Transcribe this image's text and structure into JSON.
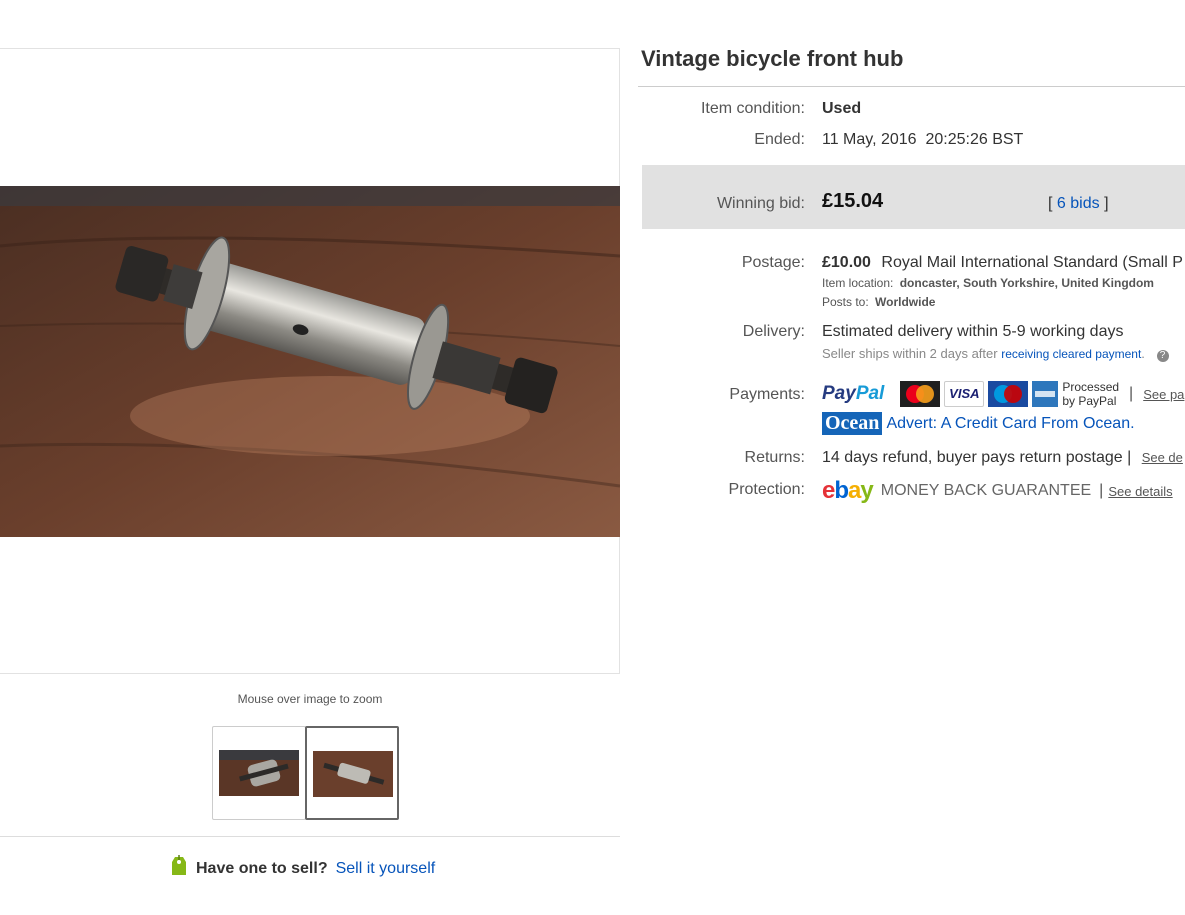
{
  "gallery": {
    "zoom_hint": "Mouse over image to zoom"
  },
  "sell": {
    "question": "Have one to sell?",
    "link": "Sell it yourself"
  },
  "item": {
    "title": "Vintage bicycle front hub",
    "condition_label": "Item condition:",
    "condition_value": "Used",
    "ended_label": "Ended:",
    "ended_value": "11 May, 2016  20:25:26 BST",
    "winning_bid_label": "Winning bid:",
    "winning_bid_value": "£15.04",
    "bids_open": "[",
    "bids_link": "6 bids",
    "bids_close": "]"
  },
  "postage": {
    "label": "Postage:",
    "price": "£10.00",
    "service": "Royal Mail International Standard (Small P",
    "location_label": "Item location:",
    "location_value": "doncaster, South Yorkshire, United Kingdom",
    "posts_to_label": "Posts to:",
    "posts_to_value": "Worldwide"
  },
  "delivery": {
    "label": "Delivery:",
    "value": "Estimated delivery within 5-9 working days",
    "seller_ships": "Seller ships within 2 days after",
    "cleared_link": "receiving cleared payment",
    "dot": "."
  },
  "payments": {
    "label": "Payments:",
    "paypal_1": "Pay",
    "paypal_2": "Pal",
    "card_mastercard": "MasterCard",
    "card_visa": "VISA",
    "card_maestro": "Maestro",
    "card_amex": "AMEX",
    "processed_1": "Processed",
    "processed_2": "by PayPal",
    "sep": "|",
    "see_link": "See pa",
    "ocean_logo": "Ocean",
    "ocean_ad": "Advert: A Credit Card From Ocean."
  },
  "returns": {
    "label": "Returns:",
    "value": "14 days refund, buyer pays return postage |",
    "see_link": "See de"
  },
  "protection": {
    "label": "Protection:",
    "ebay_e": "e",
    "ebay_b": "b",
    "ebay_a": "a",
    "ebay_y": "y",
    "guarantee": "MONEY BACK GUARANTEE",
    "sep": "|",
    "see_link": "See details"
  },
  "colors": {
    "link": "#0654ba",
    "bid_box": "#e1e1e1",
    "ebay_red": "#e53238",
    "ebay_blue": "#0064d2",
    "ebay_yellow": "#f5af02",
    "ebay_green": "#86b817"
  },
  "icons": [
    "sell-tag-icon",
    "help-icon"
  ]
}
